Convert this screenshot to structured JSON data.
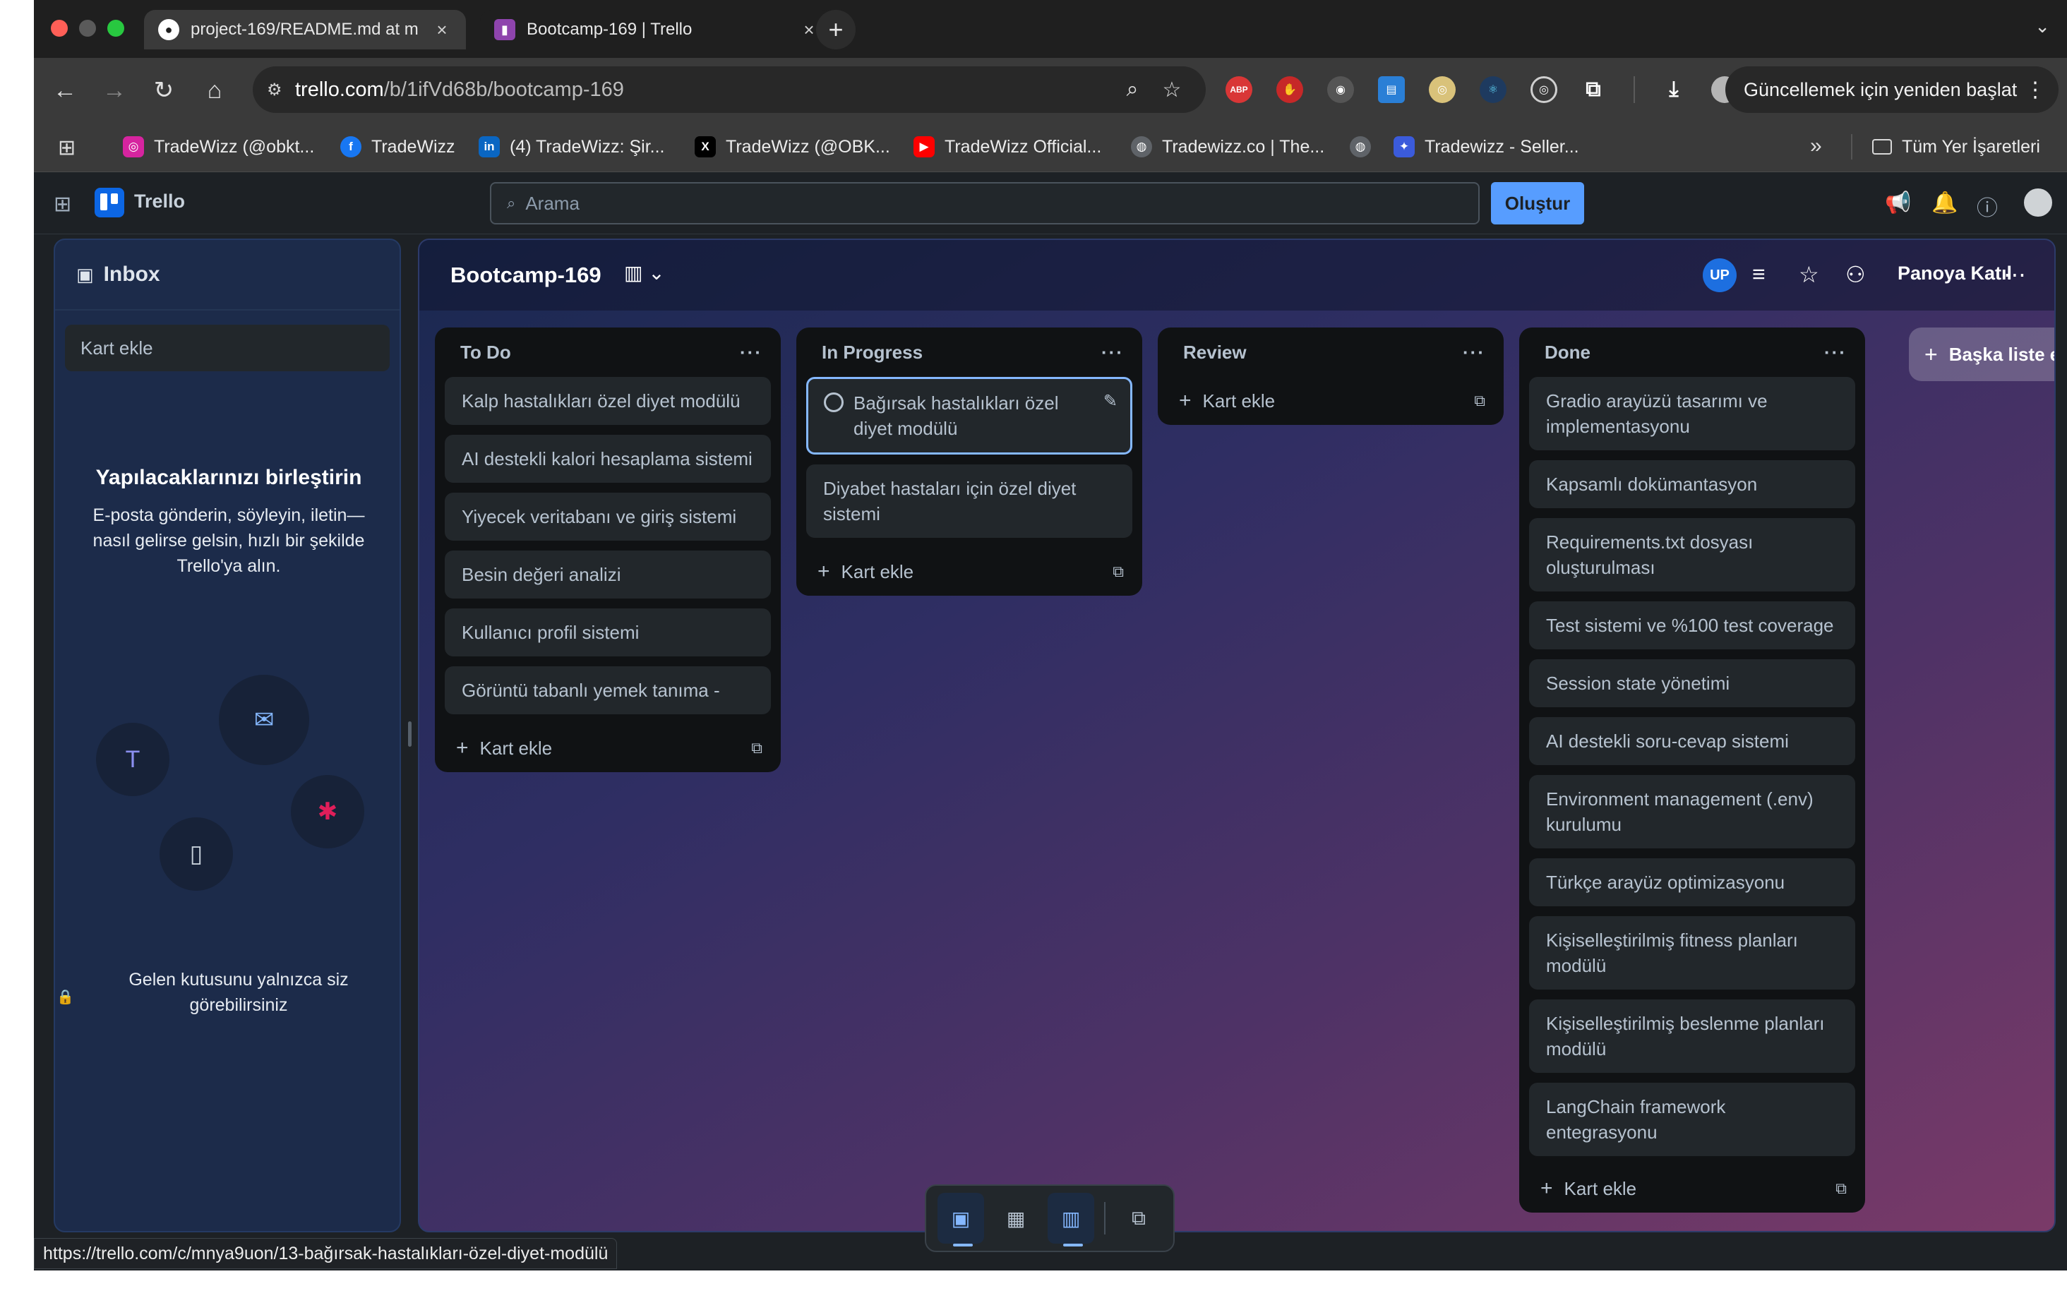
{
  "browser": {
    "tabs": [
      {
        "title": "project-169/README.md at m",
        "icon": "github-icon"
      },
      {
        "title": "Bootcamp-169 | Trello",
        "icon": "trello-icon"
      }
    ],
    "url_host": "trello.com",
    "url_path": "/b/1ifVd68b/bootcamp-169",
    "update_button": "Güncellemek için yeniden başlat",
    "bookmarks": [
      {
        "label": "TradeWizz (@obkt...",
        "icon": "instagram-icon"
      },
      {
        "label": "TradeWizz",
        "icon": "facebook-icon"
      },
      {
        "label": "(4) TradeWizz: Şir...",
        "icon": "linkedin-icon"
      },
      {
        "label": "TradeWizz (@OBK...",
        "icon": "x-icon"
      },
      {
        "label": "TradeWizz Official...",
        "icon": "youtube-icon"
      },
      {
        "label": "Tradewizz.co | The...",
        "icon": "globe-icon"
      },
      {
        "label": "Tradewizz - Seller...",
        "icon": "seller-icon"
      }
    ],
    "bookmarks_all": "Tüm Yer İşaretleri",
    "status_url": "https://trello.com/c/mnya9uon/13-bağırsak-hastalıkları-özel-diyet-modülü"
  },
  "trello": {
    "app_name": "Trello",
    "search_placeholder": "Arama",
    "create_label": "Oluştur"
  },
  "inbox": {
    "title": "Inbox",
    "add_card": "Kart ekle",
    "promo_title": "Yapılacaklarınızı birleştirin",
    "promo_desc": "E-posta gönderin, söyleyin, iletin—nasıl gelirse gelsin, hızlı bir şekilde Trello'ya alın.",
    "private_note": "Gelen kutusunu yalnızca siz görebilirsiniz"
  },
  "board": {
    "title": "Bootcamp-169",
    "member_initials": "UP",
    "join_label": "Panoya Katıl",
    "add_list": "Başka liste ekle",
    "add_card": "Kart ekle",
    "lists": [
      {
        "name": "To Do",
        "cards": [
          "Kalp hastalıkları özel diyet modülü",
          "AI destekli kalori hesaplama sistemi",
          "Yiyecek veritabanı ve giriş sistemi",
          "Besin değeri analizi",
          "Kullanıcı profil sistemi",
          "Görüntü tabanlı yemek tanıma -"
        ]
      },
      {
        "name": "In Progress",
        "cards": [
          "Bağırsak hastalıkları özel diyet modülü",
          "Diyabet hastaları için özel diyet sistemi"
        ]
      },
      {
        "name": "Review",
        "cards": []
      },
      {
        "name": "Done",
        "cards": [
          "Gradio arayüzü tasarımı ve implementasyonu",
          "Kapsamlı dokümantasyon",
          "Requirements.txt dosyası oluşturulması",
          "Test sistemi ve %100 test coverage",
          "Session state yönetimi",
          "AI destekli soru-cevap sistemi",
          "Environment management (.env) kurulumu",
          "Türkçe arayüz optimizasyonu",
          "Kişiselleştirilmiş fitness planları modülü",
          "Kişiselleştirilmiş beslenme planları modülü",
          "LangChain framework entegrasyonu"
        ]
      }
    ]
  }
}
